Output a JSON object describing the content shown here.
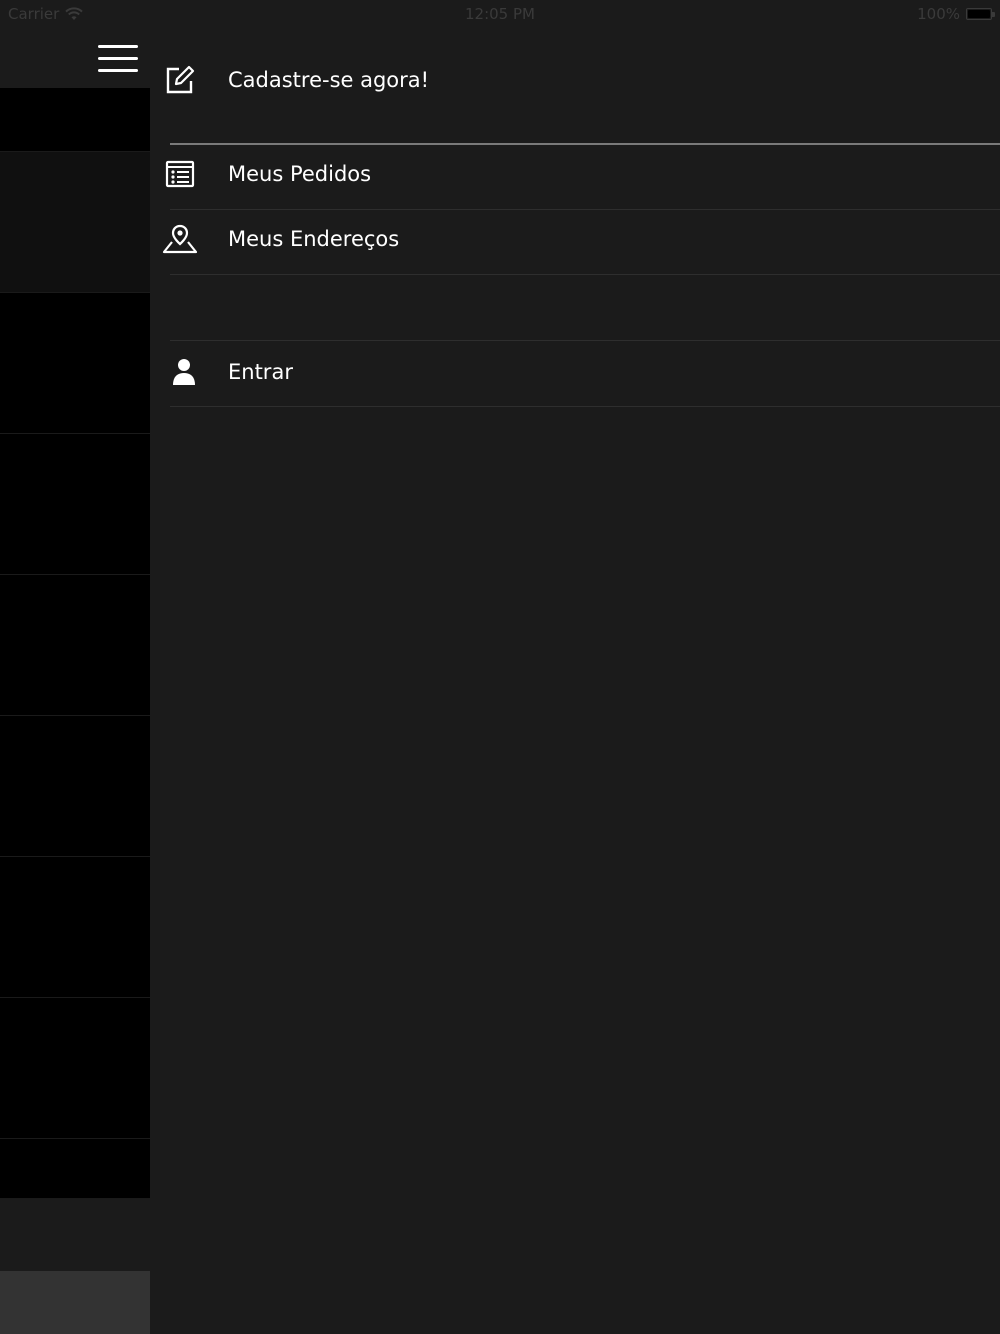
{
  "status_bar": {
    "carrier": "Carrier",
    "time": "12:05 PM",
    "battery": "100%"
  },
  "menu": {
    "register_label": "Cadastre-se agora!",
    "items": [
      {
        "label": "Meus Pedidos",
        "icon": "list-icon"
      },
      {
        "label": "Meus Endereços",
        "icon": "map-pin-icon"
      }
    ],
    "login_label": "Entrar"
  },
  "colors": {
    "background": "#1b1b1b",
    "text": "#ffffff",
    "left_blocks": "#000000"
  }
}
